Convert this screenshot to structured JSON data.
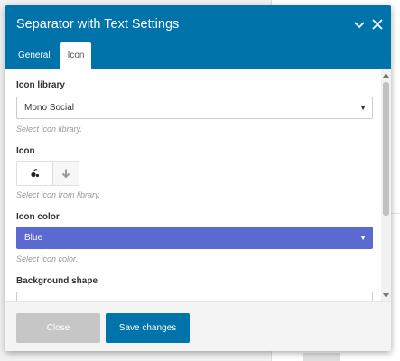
{
  "modal": {
    "title": "Separator with Text Settings",
    "tabs": [
      {
        "label": "General"
      },
      {
        "label": "Icon"
      }
    ]
  },
  "fields": {
    "icon_library": {
      "label": "Icon library",
      "value": "Mono Social",
      "help": "Select icon library."
    },
    "icon": {
      "label": "Icon",
      "help": "Select icon from library."
    },
    "icon_color": {
      "label": "Icon color",
      "value": "Blue",
      "help": "Select icon color.",
      "color": "#5a6ad0"
    },
    "background_shape": {
      "label": "Background shape"
    }
  },
  "footer": {
    "close_label": "Close",
    "save_label": "Save changes"
  },
  "colors": {
    "header": "#0073aa",
    "save_button": "#0073aa",
    "close_button": "#c6c6c6"
  }
}
